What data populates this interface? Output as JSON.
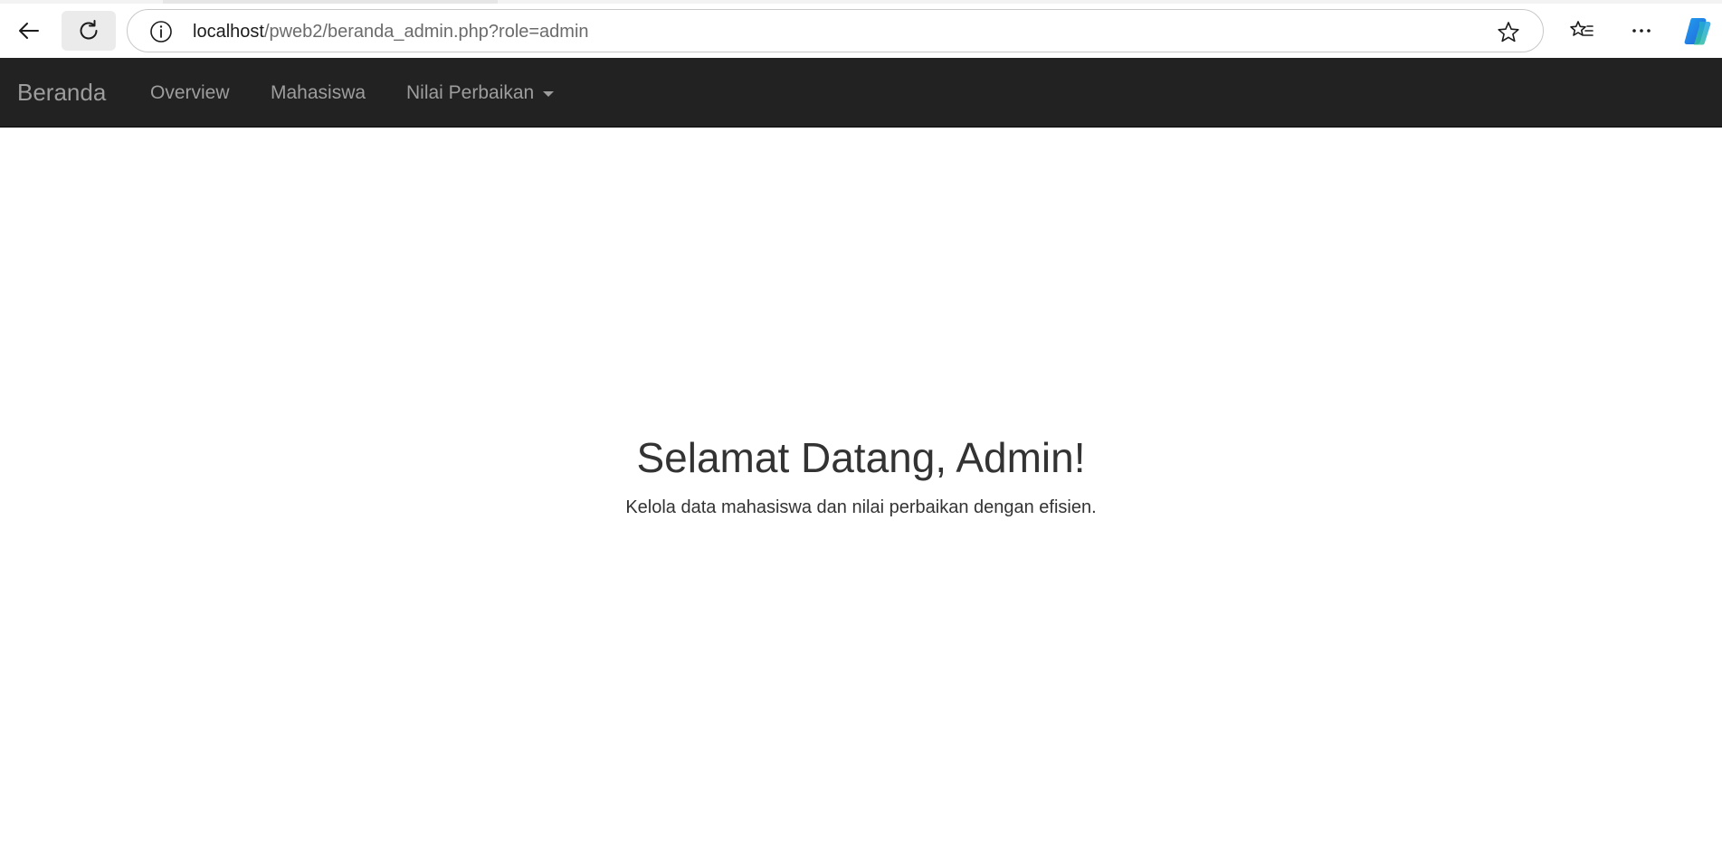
{
  "browser": {
    "url_host": "localhost",
    "url_path": "/pweb2/beranda_admin.php?role=admin"
  },
  "navbar": {
    "brand": "Beranda",
    "links": [
      {
        "label": "Overview"
      },
      {
        "label": "Mahasiswa"
      },
      {
        "label": "Nilai Perbaikan",
        "dropdown": true
      }
    ],
    "background": "#222222",
    "link_color": "#9d9d9d"
  },
  "main": {
    "title": "Selamat Datang, Admin!",
    "subtitle": "Kelola data mahasiswa dan nilai perbaikan dengan efisien."
  },
  "icons": {
    "back": "back-arrow-icon",
    "reload": "reload-icon",
    "info": "info-icon",
    "favorite": "star-icon",
    "favorites": "favorites-list-icon",
    "more": "more-icon",
    "copilot": "copilot-icon"
  }
}
